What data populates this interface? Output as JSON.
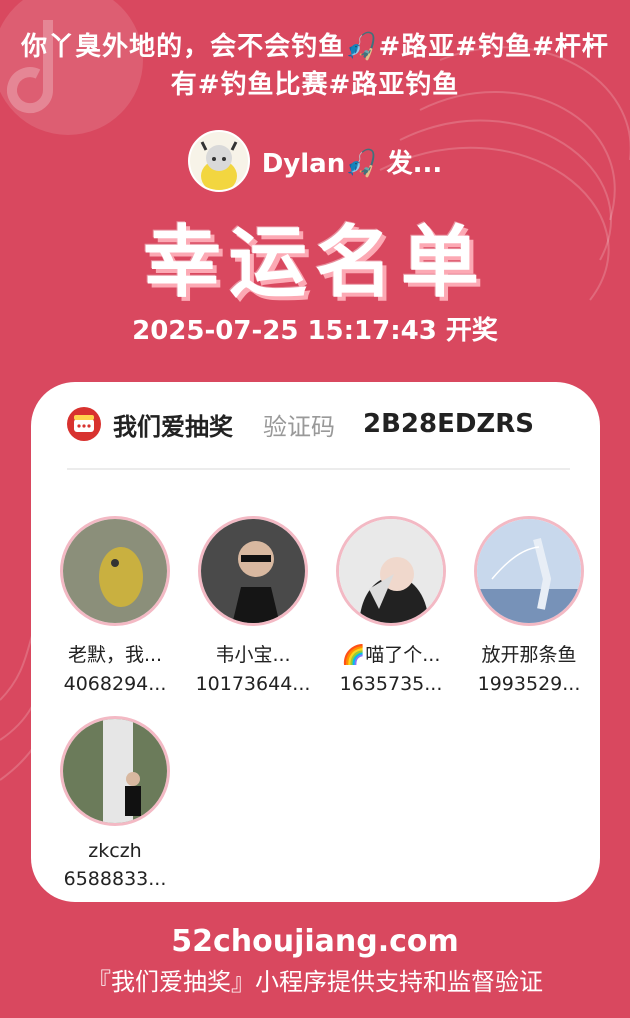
{
  "post_title": "你丫臭外地的，会不会钓鱼🎣#路亚#钓鱼#杆杆有#钓鱼比赛#路亚钓鱼",
  "host": {
    "name": "Dylan🎣 发..."
  },
  "headline": "幸运名单",
  "draw_time": "2025-07-25 15:17:43 开奖",
  "card": {
    "brand": "我们爱抽奖",
    "verify_label": "验证码",
    "verify_code": "2B28EDZRS"
  },
  "winners": [
    {
      "name": "老默，我...",
      "uid": "4068294...",
      "colors": [
        "#7a8a6a",
        "#c9b040"
      ]
    },
    {
      "name": "韦小宝...",
      "uid": "10173644...",
      "colors": [
        "#3a3a3a",
        "#1a1a1a"
      ]
    },
    {
      "name": "🌈喵了个...",
      "uid": "1635735...",
      "colors": [
        "#e9e9e9",
        "#222222"
      ]
    },
    {
      "name": "放开那条鱼",
      "uid": "1993529...",
      "colors": [
        "#c8d8ec",
        "#7792b8"
      ]
    },
    {
      "name": "zkczh",
      "uid": "6588833...",
      "colors": [
        "#6b7b5a",
        "#e6e6e6"
      ]
    }
  ],
  "footer": {
    "site": "52choujiang.com",
    "note": "『我们爱抽奖』小程序提供支持和监督验证"
  },
  "colors": {
    "background": "#d9485f",
    "card": "#ffffff",
    "brand_red": "#d8322f",
    "avatar_ring": "#f3b9c4"
  }
}
